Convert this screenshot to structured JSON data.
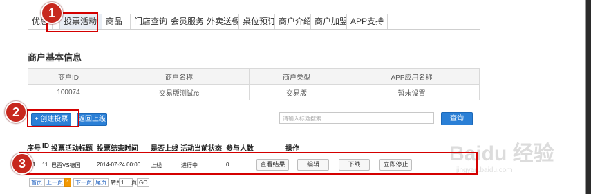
{
  "tabs": [
    "优惠",
    "投票活动",
    "商品",
    "门店查询",
    "会员服务",
    "外卖送餐",
    "桌位预订",
    "商户介绍",
    "商户加盟",
    "APP支持"
  ],
  "merchant_section": {
    "title": "商户基本信息",
    "headers": [
      "商户ID",
      "商户名称",
      "商户类型",
      "APP应用名称"
    ],
    "values": [
      "100074",
      "交易版测试rc",
      "交易版",
      "暂未设置"
    ]
  },
  "toolbar": {
    "create_label": "+ 创建投票",
    "back_label": "返回上级",
    "search_placeholder": "请输入标题搜索",
    "search_button": "查询"
  },
  "vote_table": {
    "headers": [
      "序号",
      "ID",
      "投票活动标题",
      "投票结束时间",
      "是否上线",
      "活动当前状态",
      "参与人数",
      "操作"
    ],
    "row": {
      "index": "1",
      "id": "11",
      "title": "巴西VS德国",
      "end_time": "2014-07-24 00:00",
      "online": "上线",
      "status": "进行中",
      "participants": "0",
      "actions": [
        "查看结果",
        "编辑",
        "下线",
        "立即停止"
      ]
    }
  },
  "pagination": {
    "first": "首页",
    "prev": "上一页",
    "current": "1",
    "next": "下一页",
    "last": "尾页",
    "goto_prefix": "转到",
    "goto_value": "1",
    "goto_suffix": "页",
    "go": "GO"
  },
  "callouts": [
    "1",
    "2",
    "3"
  ],
  "watermark": {
    "brand": "Baidu 经验",
    "url": "jingyan.baidu.com"
  },
  "colors": {
    "accent": "#2a7fd6",
    "callout": "#d40000",
    "current_page": "#f39800"
  }
}
